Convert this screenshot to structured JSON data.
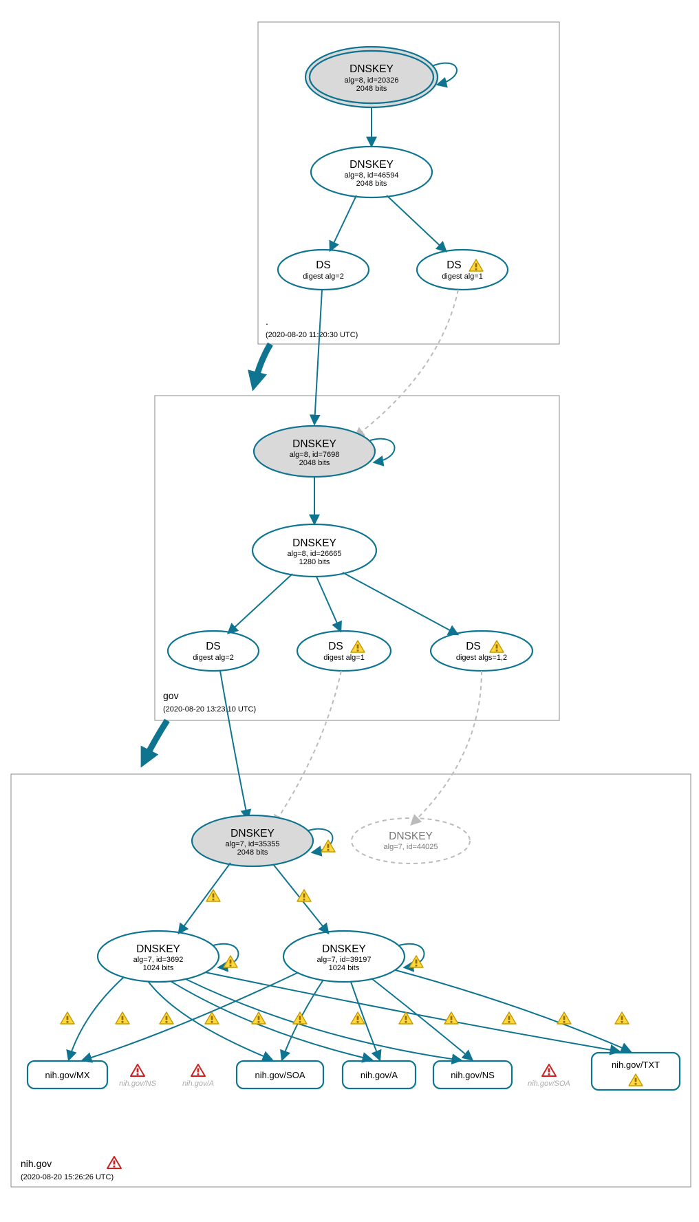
{
  "zones": {
    "root": {
      "label": ".",
      "timestamp": "(2020-08-20 11:20:30 UTC)"
    },
    "gov": {
      "label": "gov",
      "timestamp": "(2020-08-20 13:23:10 UTC)"
    },
    "nih": {
      "label": "nih.gov",
      "timestamp": "(2020-08-20 15:26:26 UTC)"
    }
  },
  "nodes": {
    "root_ksk": {
      "title": "DNSKEY",
      "line1": "alg=8, id=20326",
      "line2": "2048 bits"
    },
    "root_zsk": {
      "title": "DNSKEY",
      "line1": "alg=8, id=46594",
      "line2": "2048 bits"
    },
    "root_ds2": {
      "title": "DS",
      "line1": "digest alg=2"
    },
    "root_ds1": {
      "title": "DS",
      "line1": "digest alg=1"
    },
    "gov_ksk": {
      "title": "DNSKEY",
      "line1": "alg=8, id=7698",
      "line2": "2048 bits"
    },
    "gov_zsk": {
      "title": "DNSKEY",
      "line1": "alg=8, id=26665",
      "line2": "1280 bits"
    },
    "gov_ds2": {
      "title": "DS",
      "line1": "digest alg=2"
    },
    "gov_ds1": {
      "title": "DS",
      "line1": "digest alg=1"
    },
    "gov_ds12": {
      "title": "DS",
      "line1": "digest algs=1,2"
    },
    "nih_ksk": {
      "title": "DNSKEY",
      "line1": "alg=7, id=35355",
      "line2": "2048 bits"
    },
    "nih_ghost": {
      "title": "DNSKEY",
      "line1": "alg=7, id=44025"
    },
    "nih_zsk1": {
      "title": "DNSKEY",
      "line1": "alg=7, id=3692",
      "line2": "1024 bits"
    },
    "nih_zsk2": {
      "title": "DNSKEY",
      "line1": "alg=7, id=39197",
      "line2": "1024 bits"
    }
  },
  "rr": {
    "mx": "nih.gov/MX",
    "soa": "nih.gov/SOA",
    "a": "nih.gov/A",
    "ns": "nih.gov/NS",
    "txt": "nih.gov/TXT"
  },
  "ghost_rr": {
    "ns": "nih.gov/NS",
    "a": "nih.gov/A",
    "soa": "nih.gov/SOA"
  }
}
